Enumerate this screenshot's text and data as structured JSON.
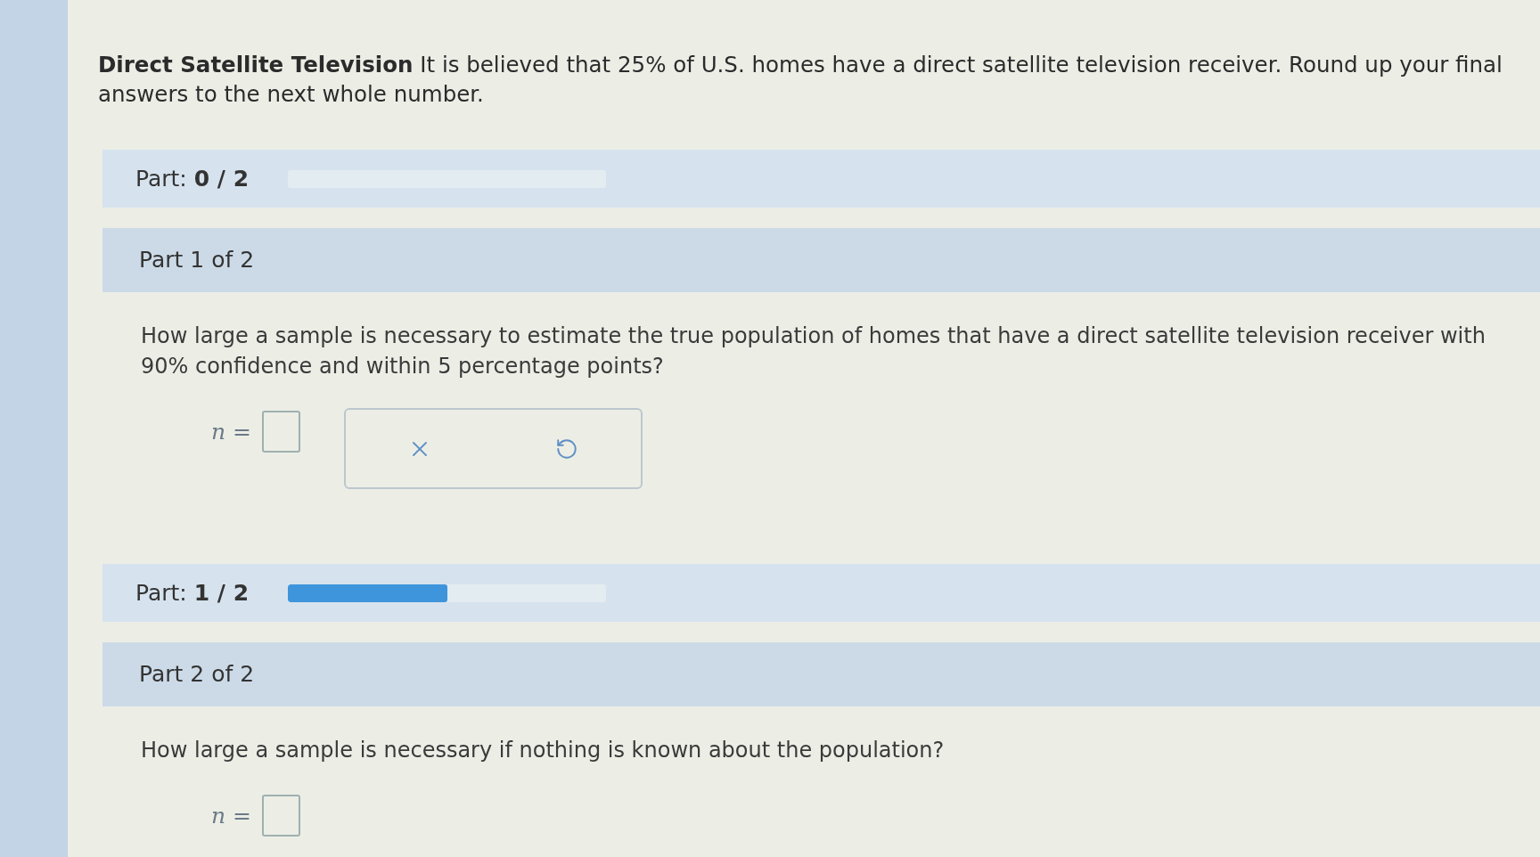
{
  "problem": {
    "statement": "**Direct Satellite Television** It is believed that 25% of U.S. homes have a direct satellite television receiver. Round up your final answers to the next whole number."
  },
  "parts": [
    {
      "progress": {
        "label": "Part: **0 / 2**",
        "level": 0
      },
      "title": "Part 1 of 2",
      "question": "How large a sample is necessary to estimate the true population of homes that have a direct satellite television receiver with 90% confidence and within 5 percentage points?",
      "answer_label": "*n* =",
      "tools": [
        {
          "kind": "clear"
        },
        {
          "kind": "undo"
        }
      ]
    },
    {
      "progress": {
        "label": "Part: **1 / 2**",
        "level": 0.5
      },
      "title": "Part 2 of 2",
      "question": "How large a sample is necessary if nothing is known about the population?",
      "answer_label": "*n* ="
    }
  ]
}
